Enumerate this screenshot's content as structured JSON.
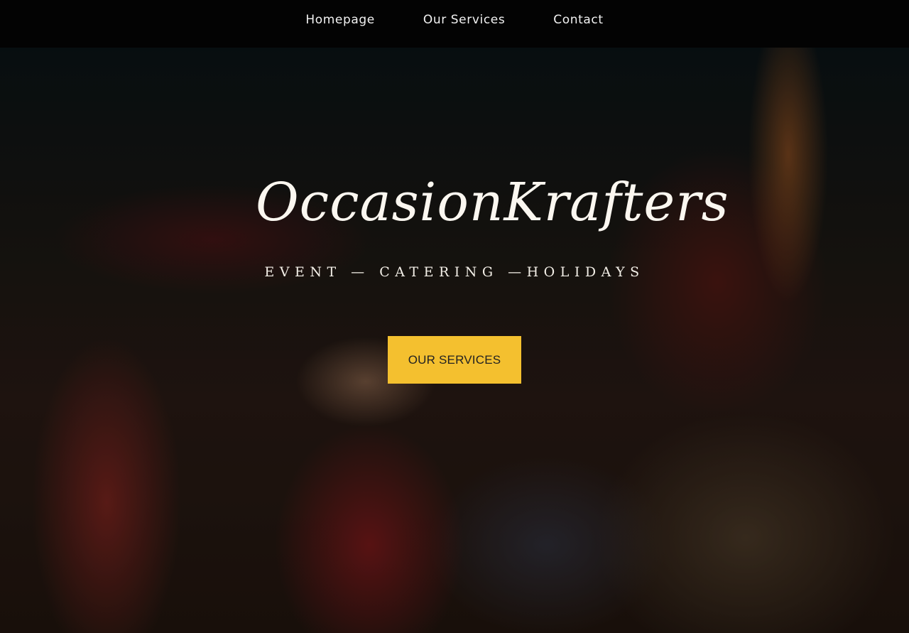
{
  "nav": {
    "items": [
      {
        "label": "Homepage"
      },
      {
        "label": "Our Services"
      },
      {
        "label": "Contact"
      }
    ]
  },
  "hero": {
    "logo_text": "OccasionKrafters",
    "tagline": "EVENT — CATERING —HOLIDAYS",
    "cta_label": "OUR SERVICES",
    "background_image": "wedding-photo"
  },
  "colors": {
    "nav_background": "#030303",
    "nav_text": "#f2f2f2",
    "cta_background": "#f4c02f",
    "cta_text": "#222222",
    "logo_text": "#fbf7f0"
  }
}
